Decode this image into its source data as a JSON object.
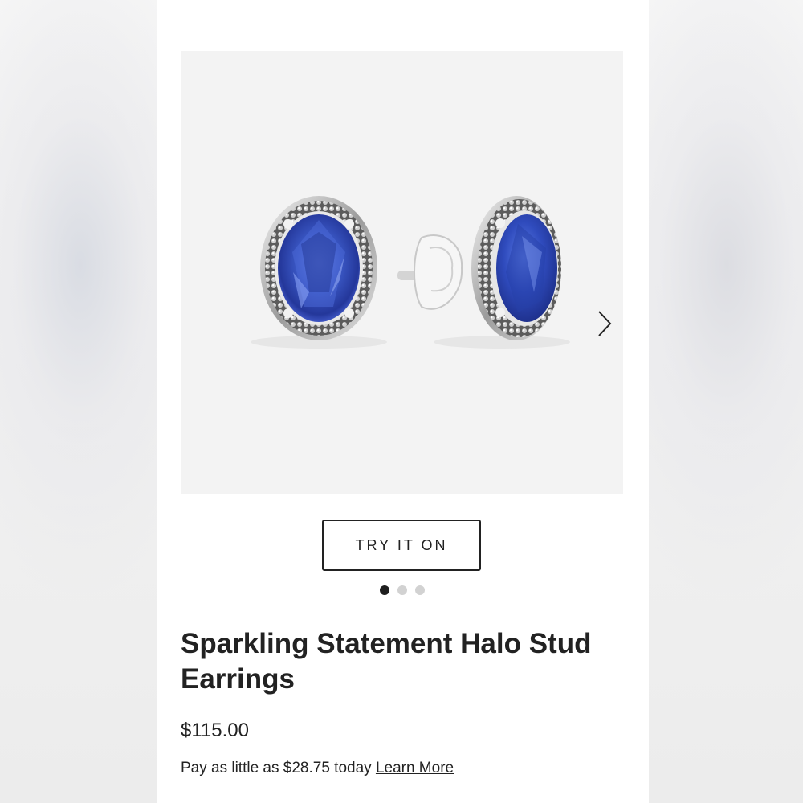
{
  "gallery": {
    "image_icon": "sapphire-halo-stud-earrings-photo",
    "next_icon": "chevron-right-icon",
    "try_on_label": "TRY IT ON",
    "dots_count": 3,
    "active_dot": 1
  },
  "product": {
    "title": "Sparkling Statement Halo Stud Earrings",
    "price": "$115.00",
    "installment_text": "Pay as little as $28.75 today",
    "learn_more_label": "Learn More"
  },
  "colors": {
    "stone": "#3a57c4",
    "text": "#222222",
    "gallery_bg": "#f3f3f3"
  }
}
